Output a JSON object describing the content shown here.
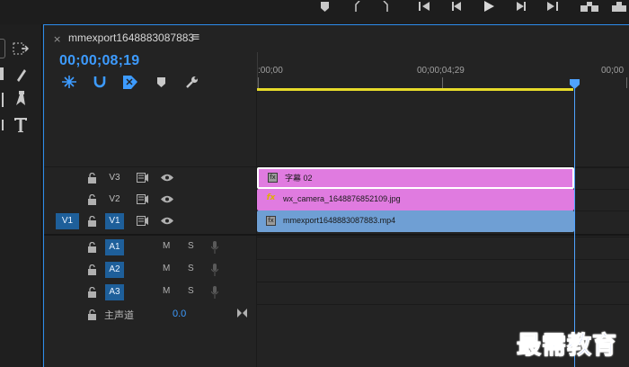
{
  "sequence_tab": {
    "close_glyph": "×",
    "title": "mmexport1648883087883",
    "menu_glyph": "≡"
  },
  "timecode": "00;00;08;19",
  "ruler": {
    "labels": [
      ":00;00",
      "00;00;04;29",
      "00;00"
    ]
  },
  "tracks": {
    "video": [
      {
        "name": "V3"
      },
      {
        "name": "V2"
      },
      {
        "name": "V1",
        "source": "V1"
      }
    ],
    "audio": [
      {
        "name": "A1",
        "mute": "M",
        "solo": "S"
      },
      {
        "name": "A2",
        "mute": "M",
        "solo": "S"
      },
      {
        "name": "A3",
        "mute": "M",
        "solo": "S"
      }
    ],
    "master": {
      "label": "主声道",
      "value": "0.0"
    }
  },
  "clips": [
    {
      "track": "V3",
      "label": "字幕 02",
      "badge": "fx",
      "color": "#e07be0"
    },
    {
      "track": "V2",
      "label": "wx_camera_1648876852109.jpg",
      "badge": "fx",
      "color": "#e07be0"
    },
    {
      "track": "V1",
      "label": "mmexport1648883087883.mp4",
      "badge": "fx",
      "color": "#6f9fd4"
    }
  ],
  "colors": {
    "accent": "#2d8ceb",
    "timecode": "#3d9bff",
    "work_area": "#e6db2a",
    "track_active": "#1e5f9a"
  },
  "watermark": "最需教育"
}
